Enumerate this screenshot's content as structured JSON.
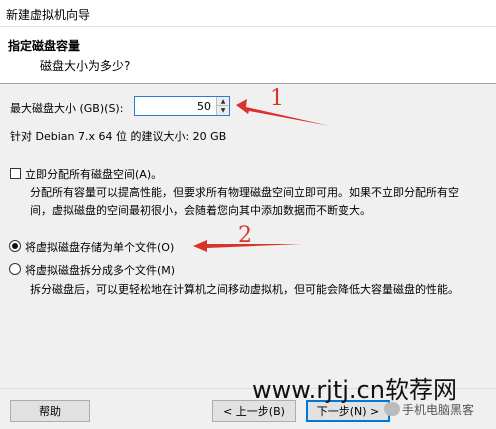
{
  "window": {
    "title": "新建虚拟机向导"
  },
  "header": {
    "title": "指定磁盘容量",
    "subtitle": "磁盘大小为多少?"
  },
  "disk": {
    "size_label": "最大磁盘大小 (GB)(S):",
    "size_value": "50",
    "recommend": "针对 Debian 7.x 64 位 的建议大小: 20 GB"
  },
  "allocate": {
    "label": "立即分配所有磁盘空间(A)。",
    "checked": false,
    "desc": "分配所有容量可以提高性能，但要求所有物理磁盘空间立即可用。如果不立即分配所有空间，虚拟磁盘的空间最初很小，会随着您向其中添加数据而不断变大。"
  },
  "storage": {
    "single_label": "将虚拟磁盘存储为单个文件(O)",
    "single_checked": true,
    "split_label": "将虚拟磁盘拆分成多个文件(M)",
    "split_checked": false,
    "split_desc": "拆分磁盘后，可以更轻松地在计算机之间移动虚拟机，但可能会降低大容量磁盘的性能。"
  },
  "annotations": {
    "one": "1",
    "two": "2",
    "color": "#d9342b"
  },
  "buttons": {
    "help": "帮助",
    "back": "< 上一步(B)",
    "next": "下一步(N) >"
  },
  "watermark": {
    "url": "www.rjtj.cn软荐网",
    "label": "手机电脑黑客"
  }
}
